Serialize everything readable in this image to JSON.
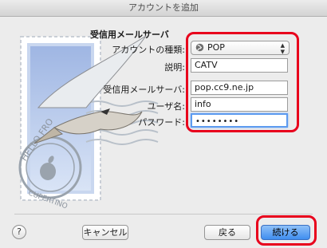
{
  "window": {
    "title": "アカウントを追加"
  },
  "section": {
    "title": "受信用メールサーバ"
  },
  "stamp": {
    "text_top": "HELLO FRO",
    "text_bottom": "CUPERTINO"
  },
  "form": {
    "account_type_label": "アカウントの種類:",
    "account_type_value": "POP",
    "description_label": "説明:",
    "description_value": "CATV",
    "server_label": "受信用メールサーバ:",
    "server_value": "pop.cc9.ne.jp",
    "username_label": "ユーザ名:",
    "username_value": "info",
    "password_label": "パスワード:",
    "password_value": "••••••••"
  },
  "buttons": {
    "help": "?",
    "cancel": "キャンセル",
    "back": "戻る",
    "continue": "続ける"
  },
  "colors": {
    "highlight": "#e8001c",
    "accent": "#3f8ef0"
  }
}
